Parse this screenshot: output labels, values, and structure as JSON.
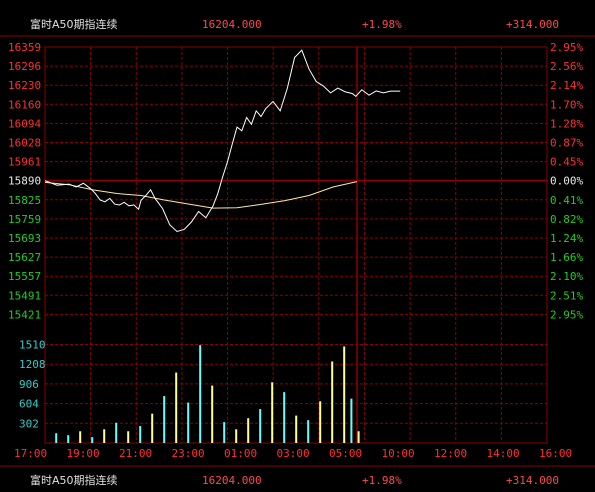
{
  "header": {
    "instrument": "富时A50期指连续",
    "last_price": "16204.000",
    "change_pct": "+1.98%",
    "change_abs": "+314.000"
  },
  "footer": {
    "instrument": "富时A50期指连续",
    "last_price": "16204.000",
    "change_pct": "+1.98%",
    "change_abs": "+314.000"
  },
  "colors": {
    "background": "#000000",
    "grid": "#8a0000",
    "up": "#ff3030",
    "down": "#22cc22",
    "neutral": "#e8e8e8",
    "price_line": "#ffffff",
    "avg_line": "#ffe8a0",
    "volume_up": "#ffff99",
    "volume_down": "#66ffff",
    "volume_label": "#33cccc"
  },
  "chart_data": {
    "type": "line",
    "title": "",
    "reference_price": 15890,
    "price_ticks": [
      {
        "price": "16359",
        "pct": "2.95%"
      },
      {
        "price": "16296",
        "pct": "2.56%"
      },
      {
        "price": "16230",
        "pct": "2.14%"
      },
      {
        "price": "16160",
        "pct": "1.70%"
      },
      {
        "price": "16094",
        "pct": "1.28%"
      },
      {
        "price": "16028",
        "pct": "0.87%"
      },
      {
        "price": "15961",
        "pct": "0.45%"
      },
      {
        "price": "15890",
        "pct": "0.00%"
      },
      {
        "price": "15825",
        "pct": "0.41%"
      },
      {
        "price": "15759",
        "pct": "0.82%"
      },
      {
        "price": "15693",
        "pct": "1.24%"
      },
      {
        "price": "15627",
        "pct": "1.66%"
      },
      {
        "price": "15557",
        "pct": "2.10%"
      },
      {
        "price": "15491",
        "pct": "2.51%"
      },
      {
        "price": "15421",
        "pct": "2.95%"
      }
    ],
    "volume_ticks": [
      "1510",
      "1208",
      "906",
      "604",
      "302"
    ],
    "time_labels": [
      "17:00",
      "19:00",
      "21:00",
      "23:00",
      "01:00",
      "03:00",
      "05:00",
      "10:00",
      "12:00",
      "14:00",
      "16:00"
    ],
    "price_series_hours": [
      0,
      0.5,
      1,
      1.3,
      1.6,
      1.9,
      2.1,
      2.3,
      2.5,
      2.7,
      2.9,
      3.1,
      3.3,
      3.5,
      3.7,
      3.9,
      4.0,
      4.2,
      4.4,
      4.6,
      4.9,
      5.2,
      5.5,
      5.8,
      6.1,
      6.4,
      6.7,
      7.0,
      7.2,
      7.4,
      7.6,
      7.8,
      8.0,
      8.2,
      8.4,
      8.6,
      8.8,
      9.0,
      9.2,
      9.5,
      9.8,
      10.1,
      10.4,
      10.7,
      11.0,
      11.3,
      11.6,
      11.9,
      12.2,
      12.5,
      12.8,
      12.95,
      13.2,
      13.5,
      13.8,
      14.1,
      14.4,
      14.8
    ],
    "price_series": [
      15890,
      15874,
      15878,
      15868,
      15881,
      15862,
      15845,
      15822,
      15816,
      15828,
      15808,
      15805,
      15814,
      15802,
      15805,
      15790,
      15821,
      15838,
      15858,
      15826,
      15792,
      15735,
      15712,
      15719,
      15745,
      15782,
      15760,
      15801,
      15845,
      15903,
      15955,
      16018,
      16078,
      16065,
      16112,
      16088,
      16135,
      16115,
      16143,
      16168,
      16135,
      16215,
      16322,
      16348,
      16282,
      16238,
      16222,
      16198,
      16215,
      16202,
      16196,
      16186,
      16209,
      16190,
      16205,
      16198,
      16204,
      16204
    ],
    "avg_series_hours": [
      0,
      1,
      2,
      3,
      4,
      5,
      6,
      7,
      8,
      9,
      10,
      11,
      12,
      12.95
    ],
    "avg_series": [
      15884,
      15876,
      15858,
      15845,
      15838,
      15822,
      15808,
      15794,
      15795,
      15807,
      15820,
      15838,
      15868,
      15886
    ],
    "volume_hours": [
      0.3,
      0.8,
      1.3,
      1.8,
      2.3,
      2.8,
      3.3,
      3.8,
      4.3,
      4.8,
      5.3,
      5.8,
      6.3,
      6.8,
      7.3,
      7.8,
      8.3,
      8.8,
      9.3,
      9.8,
      10.3,
      10.8,
      11.3,
      11.8,
      12.3,
      12.6,
      12.9
    ],
    "volume_series": [
      150,
      120,
      180,
      90,
      210,
      310,
      180,
      260,
      450,
      720,
      1080,
      620,
      1500,
      880,
      320,
      210,
      380,
      520,
      930,
      780,
      420,
      350,
      640,
      1250,
      1480,
      680,
      180
    ],
    "volume_direction": [
      "down",
      "down",
      "up",
      "down",
      "up",
      "down",
      "up",
      "down",
      "up",
      "down",
      "up",
      "down",
      "down",
      "up",
      "down",
      "up",
      "up",
      "down",
      "up",
      "down",
      "up",
      "down",
      "up",
      "up",
      "up",
      "down",
      "up"
    ]
  }
}
